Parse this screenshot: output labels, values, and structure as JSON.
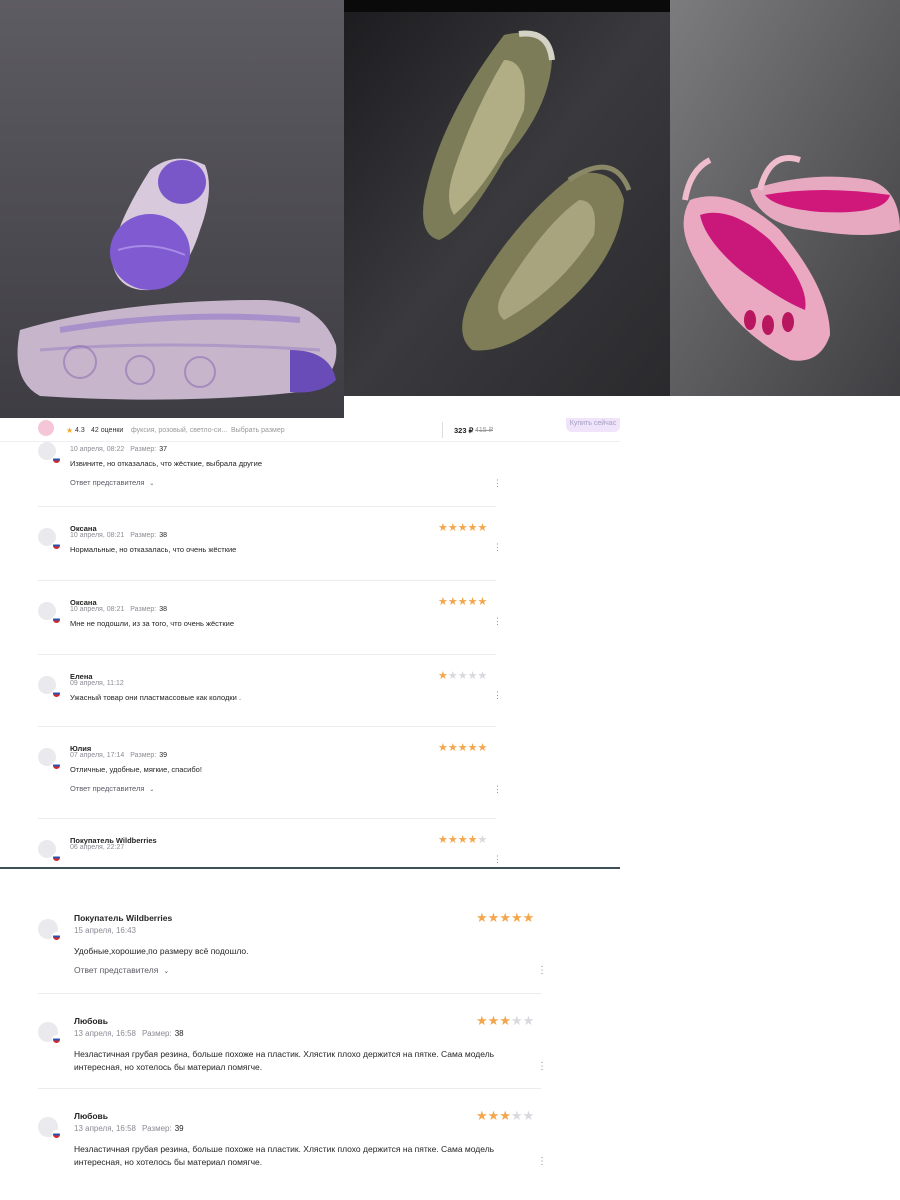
{
  "photos": [
    {
      "alt": "lavender jelly flats with purple soles"
    },
    {
      "alt": "olive slingback jelly flats"
    },
    {
      "alt": "pink slingback jelly flats with fuchsia insole"
    }
  ],
  "product_bar": {
    "rating": "4.3",
    "ratings_count": "42 оценки",
    "colors": "фуксия, розовый, светло-си...",
    "choose_size": "Выбрать размер",
    "price": "323 ₽",
    "old_price": "415 ₽",
    "buy_button": "Купить сейчас"
  },
  "reviews_a": [
    {
      "author": "",
      "date": "10 апреля, 08:22",
      "size_label": "Размер:",
      "size": "37",
      "stars": 0,
      "text": "Извините, но отказалась, что жёсткие, выбрала другие",
      "reply": "Ответ представителя"
    },
    {
      "author": "Оксана",
      "date": "10 апреля, 08:21",
      "size_label": "Размер:",
      "size": "38",
      "stars": 5,
      "text": "Нормальные, но отказалась, что очень жёсткие",
      "reply": ""
    },
    {
      "author": "Оксана",
      "date": "10 апреля, 08:21",
      "size_label": "Размер:",
      "size": "38",
      "stars": 5,
      "text": "Мне не подошли, из за того, что очень жёсткие",
      "reply": ""
    },
    {
      "author": "Елена",
      "date": "09 апреля, 11:12",
      "size_label": "",
      "size": "",
      "stars": 1,
      "text": "Ужасный товар они пластмассовые как колодки .",
      "reply": ""
    },
    {
      "author": "Юлия",
      "date": "07 апреля, 17:14",
      "size_label": "Размер:",
      "size": "39",
      "stars": 5,
      "text": "Отличные, удобные, мягкие, спасибо!",
      "reply": "Ответ представителя"
    },
    {
      "author": "Покупатель Wildberries",
      "date": "06 апреля, 22:27",
      "size_label": "",
      "size": "",
      "stars": 4,
      "text": "",
      "reply": ""
    }
  ],
  "reviews_b": [
    {
      "author": "Покупатель Wildberries",
      "date": "15 апреля, 16:43",
      "size_label": "",
      "size": "",
      "stars": 5,
      "text": "Удобные,хорошие,по размеру всё подошло.",
      "reply": "Ответ представителя"
    },
    {
      "author": "Любовь",
      "date": "13 апреля, 16:58",
      "size_label": "Размер:",
      "size": "38",
      "stars": 3,
      "text": "Незластичная грубая резина, больше похоже на пластик. Хлястик плохо держится на пятке. Сама модель интересная, но хотелось бы материал помягче.",
      "reply": ""
    },
    {
      "author": "Любовь",
      "date": "13 апреля, 16:58",
      "size_label": "Размер:",
      "size": "39",
      "stars": 3,
      "text": "Незластичная грубая резина, больше похоже на пластик. Хлястик плохо держится на пятке. Сама модель интересная, но хотелось бы материал помягче.",
      "reply": ""
    }
  ],
  "icons": {
    "more": "more-vertical-icon",
    "chevron": "chevron-down-icon",
    "star": "star-icon",
    "flag": "ru-flag-icon"
  },
  "colors": {
    "star_on": "#f3a64b",
    "star_off": "#d8d8de",
    "muted": "#8b8b95"
  }
}
